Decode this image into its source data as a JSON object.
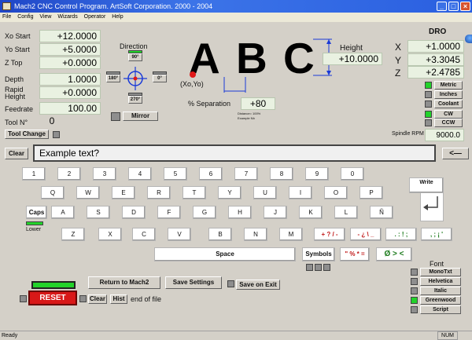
{
  "window": {
    "title": "Mach2 CNC Control Program.  ArtSoft Corporation. 2000 - 2004"
  },
  "menu": [
    "File",
    "Config",
    "View",
    "Wizards",
    "Operator",
    "Help"
  ],
  "fields": {
    "xo_start": {
      "label": "Xo Start",
      "value": "+12.0000"
    },
    "yo_start": {
      "label": "Yo Start",
      "value": "+5.0000"
    },
    "z_top": {
      "label": "Z Top",
      "value": "+0.0000"
    },
    "depth": {
      "label": "Depth",
      "value": "1.0000"
    },
    "rapid_height": {
      "label": "Rapid Height",
      "value": "+0.0000"
    },
    "feedrate": {
      "label": "Feedrate",
      "value": "100.00"
    },
    "tool_no": {
      "label": "Tool N°",
      "value": "0"
    }
  },
  "tool_change_label": "Tool Change",
  "direction": {
    "title": "Direction",
    "top": "90°",
    "left": "180°",
    "right": "0°",
    "bottom": "270°",
    "mirror": "Mirror"
  },
  "preview": {
    "letters": [
      "A",
      "B",
      "C"
    ],
    "origin": "(Xo,Yo)",
    "height_label": "Height",
    "height_value": "+10.0000",
    "separation_label": "% Separation",
    "separation_value": "+80",
    "note1": "Distance= 100%",
    "note2": "Example Nb"
  },
  "dro": {
    "title": "DRO",
    "x_label": "X",
    "x": "+1.0000",
    "y_label": "Y",
    "y": "+3.3045",
    "z_label": "Z",
    "z": "+2.4785"
  },
  "modes": [
    {
      "label": "Metric",
      "on": true
    },
    {
      "label": "Inches",
      "on": false
    },
    {
      "label": "Coolant",
      "on": false
    },
    {
      "label": "CW",
      "on": true
    },
    {
      "label": "CCW",
      "on": false
    }
  ],
  "spindle": {
    "label": "Spindle RPM",
    "value": "9000.0"
  },
  "text_entry": {
    "clear": "Clear",
    "value": "Example text?",
    "backspace": "<—"
  },
  "keys": {
    "row1": [
      "1",
      "2",
      "3",
      "4",
      "5",
      "6",
      "7",
      "8",
      "9",
      "0"
    ],
    "row2": [
      "Q",
      "W",
      "E",
      "R",
      "T",
      "Y",
      "U",
      "I",
      "O",
      "P"
    ],
    "row3": [
      "A",
      "S",
      "D",
      "F",
      "G",
      "H",
      "J",
      "K",
      "L",
      "Ñ"
    ],
    "row4": [
      "Z",
      "X",
      "C",
      "V",
      "B",
      "N",
      "M"
    ],
    "sym_row4": [
      "+ ? / -",
      "- ¿ \\ _",
      ". : ! ;",
      ", ; ¡ '"
    ],
    "sym_row5": [
      "\" % * =",
      "Ø > <"
    ],
    "caps": "Caps",
    "lower": "Lower",
    "write": "Write",
    "space": "Space",
    "symbols": "Symbols"
  },
  "fonts": {
    "title": "Font",
    "items": [
      {
        "label": "MonoTxt",
        "on": false
      },
      {
        "label": "Helvetica",
        "on": false
      },
      {
        "label": "Italic",
        "on": false
      },
      {
        "label": "Greenwood",
        "on": true
      },
      {
        "label": "Script",
        "on": false
      }
    ]
  },
  "bottom": {
    "return": "Return to Mach2",
    "save_settings": "Save Settings",
    "save_on_exit": "Save on Exit",
    "reset": "RESET",
    "clear": "Clear",
    "hist": "Hist",
    "eof": "end of file"
  },
  "statusbar": {
    "left": "Ready",
    "num": "NUM"
  },
  "colors": {
    "title_blue": "#2a5fe0",
    "field_green": "#e9f1e1",
    "led_green": "#22d22a",
    "reset_red": "#d81818",
    "origin_red": "#e01818",
    "dimension_blue": "#1a3ad8"
  }
}
